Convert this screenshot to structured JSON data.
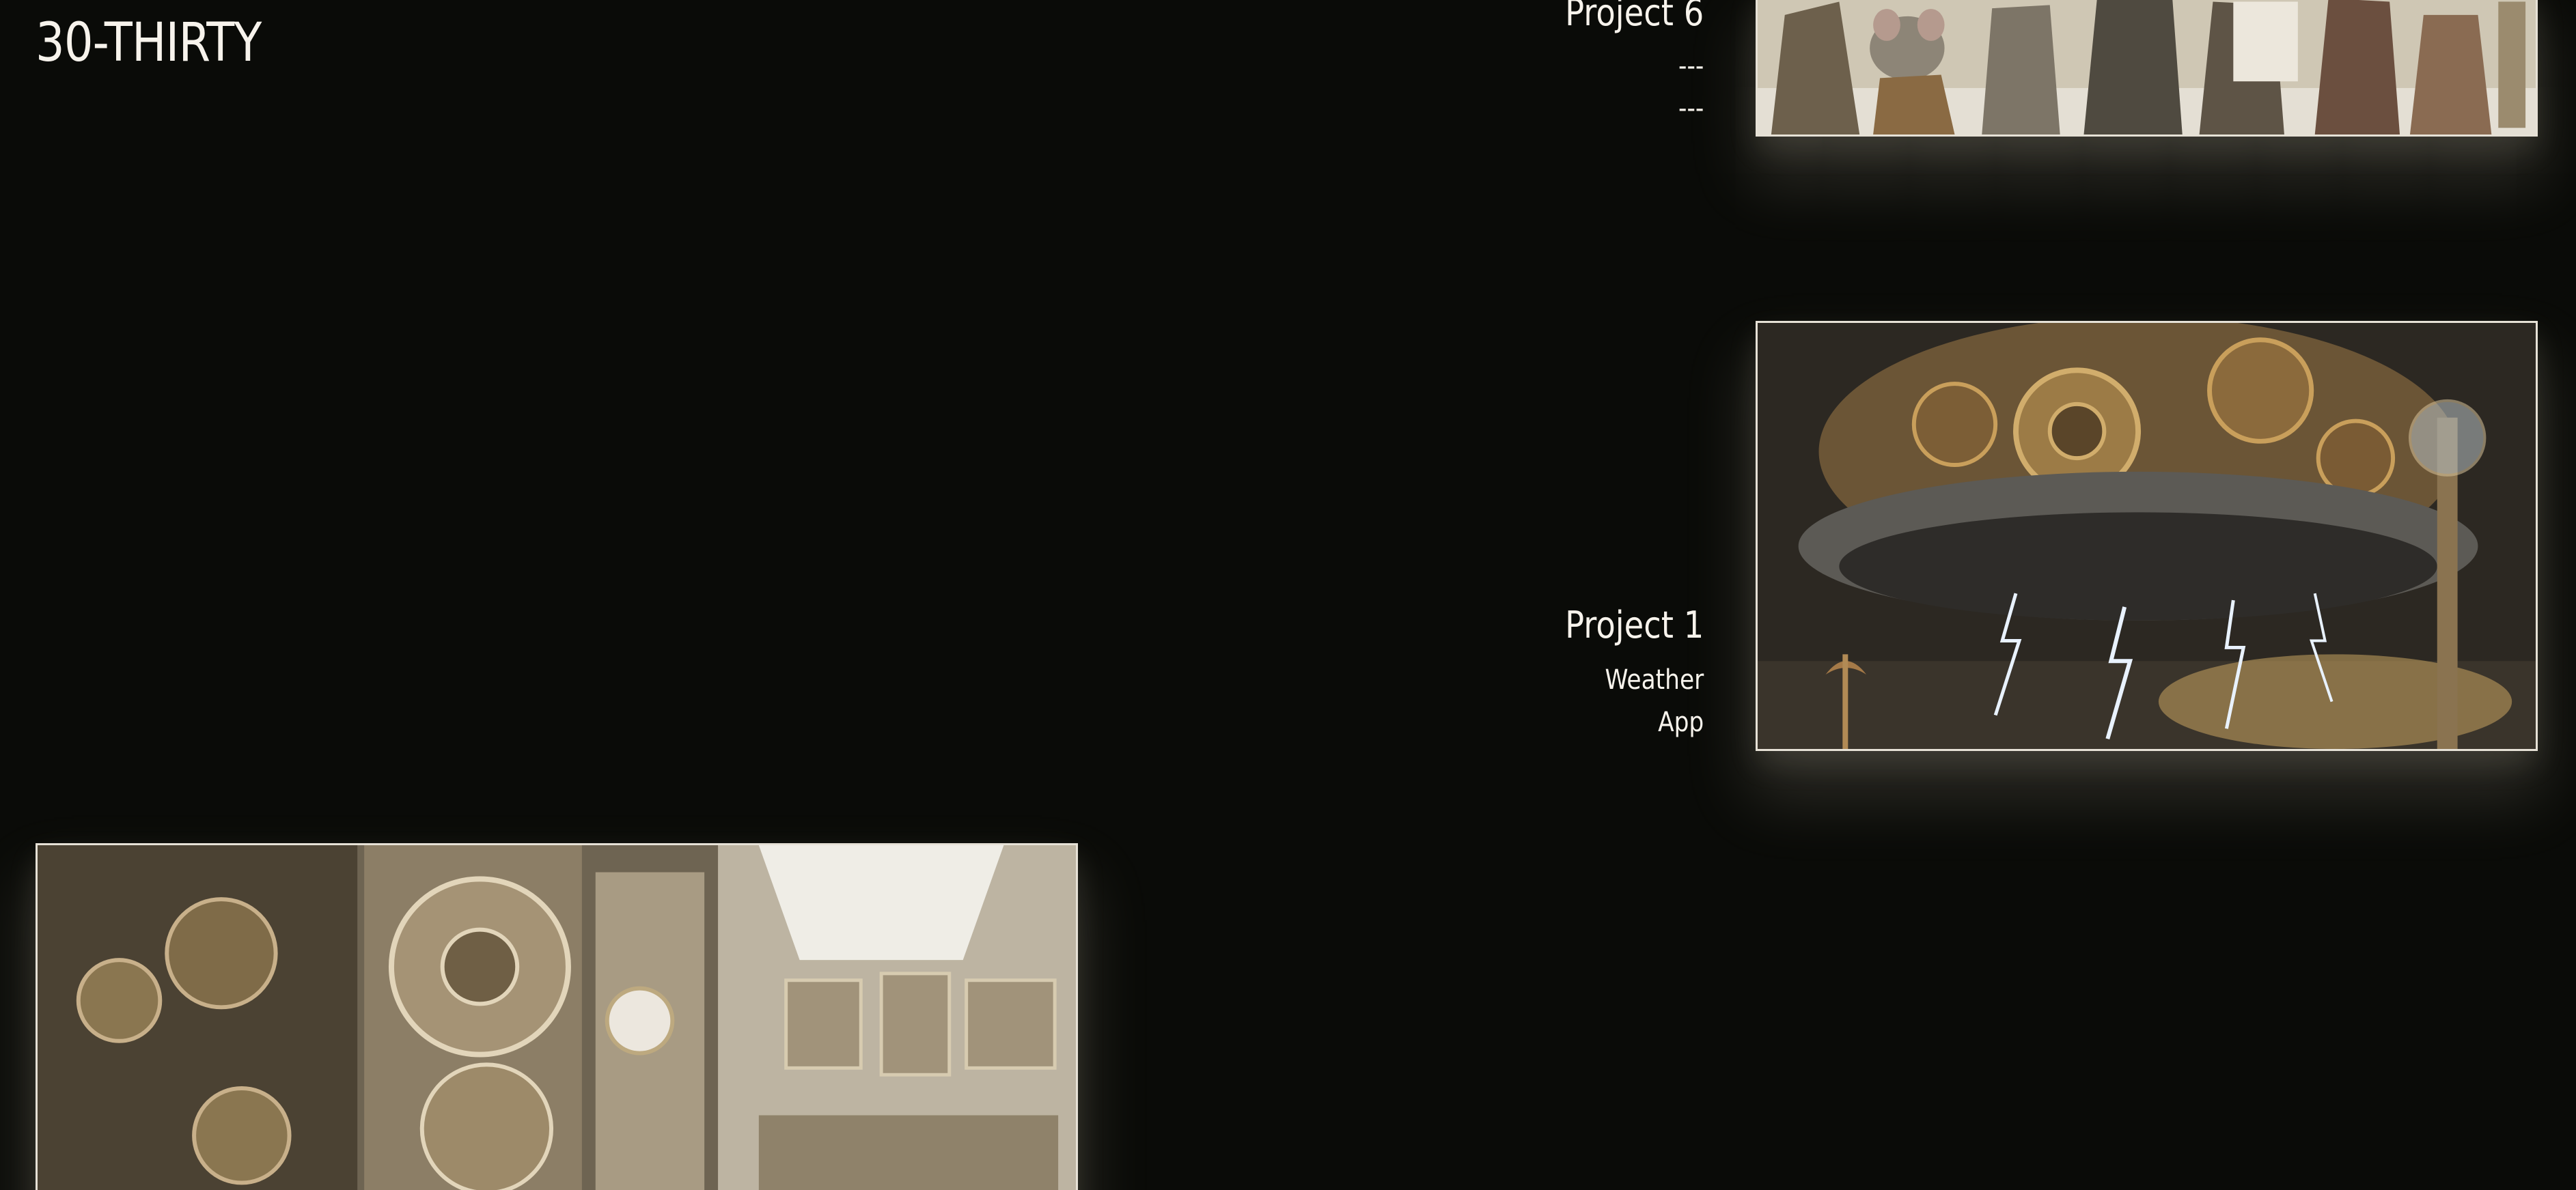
{
  "site": {
    "title": "30-THIRTY"
  },
  "projects": [
    {
      "title": "Project 6",
      "description_lines": [
        "---",
        "---"
      ],
      "image_icon": "steampunk-rat-crowd-image"
    },
    {
      "title": "Project 1",
      "description_lines": [
        "Weather",
        "App"
      ],
      "image_icon": "steampunk-storm-cloud-image"
    }
  ],
  "workshop_card": {
    "image_icon": "steampunk-clockwork-workshop-image"
  },
  "colors": {
    "background": "#0a0b08",
    "text": "#f7f3ec",
    "card_border": "#e6e1d6",
    "card_glow": "#d7cdb9"
  }
}
